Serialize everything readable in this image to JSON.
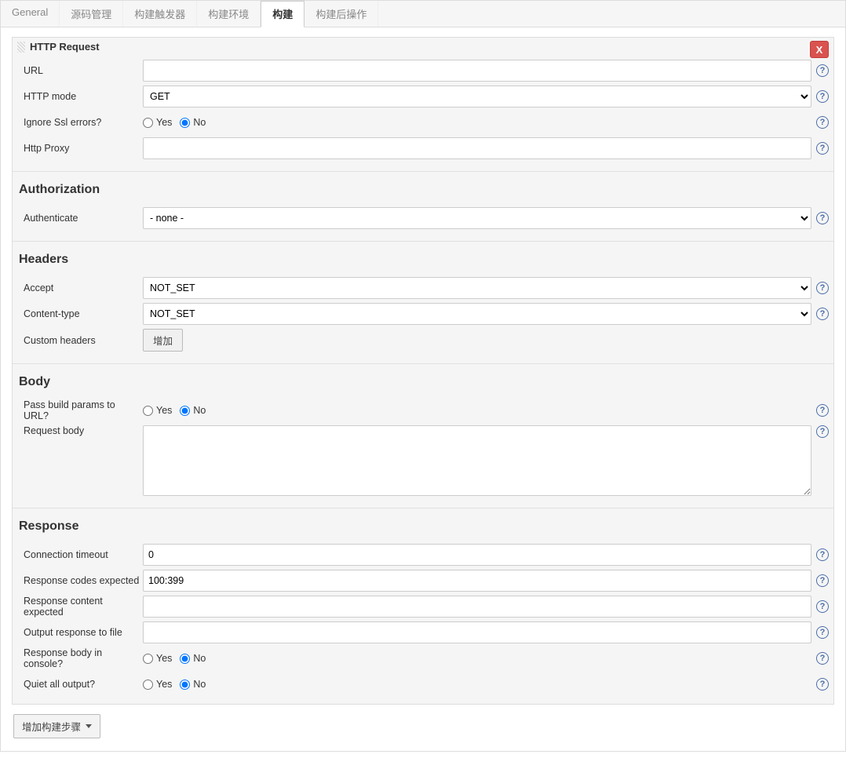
{
  "tabs": [
    {
      "label": "General"
    },
    {
      "label": "源码管理"
    },
    {
      "label": "构建触发器"
    },
    {
      "label": "构建环境"
    },
    {
      "label": "构建"
    },
    {
      "label": "构建后操作"
    }
  ],
  "panel": {
    "title": "HTTP Request",
    "close": "X"
  },
  "http": {
    "url_label": "URL",
    "url_value": "",
    "mode_label": "HTTP mode",
    "mode_value": "GET",
    "ignore_ssl_label": "Ignore Ssl errors?",
    "proxy_label": "Http Proxy",
    "proxy_value": ""
  },
  "auth": {
    "section": "Authorization",
    "authenticate_label": "Authenticate",
    "authenticate_value": "- none -"
  },
  "headers": {
    "section": "Headers",
    "accept_label": "Accept",
    "accept_value": "NOT_SET",
    "content_type_label": "Content-type",
    "content_type_value": "NOT_SET",
    "custom_label": "Custom headers",
    "add_button": "增加"
  },
  "body": {
    "section": "Body",
    "pass_params_label": "Pass build params to URL?",
    "request_body_label": "Request body",
    "request_body_value": ""
  },
  "response": {
    "section": "Response",
    "timeout_label": "Connection timeout",
    "timeout_value": "0",
    "codes_label": "Response codes expected",
    "codes_value": "100:399",
    "content_label": "Response content expected",
    "content_value": "",
    "outfile_label": "Output response to file",
    "outfile_value": "",
    "console_label": "Response body in console?",
    "quiet_label": "Quiet all output?"
  },
  "radios": {
    "yes": "Yes",
    "no": "No"
  },
  "footer": {
    "add_step": "增加构建步骤"
  }
}
